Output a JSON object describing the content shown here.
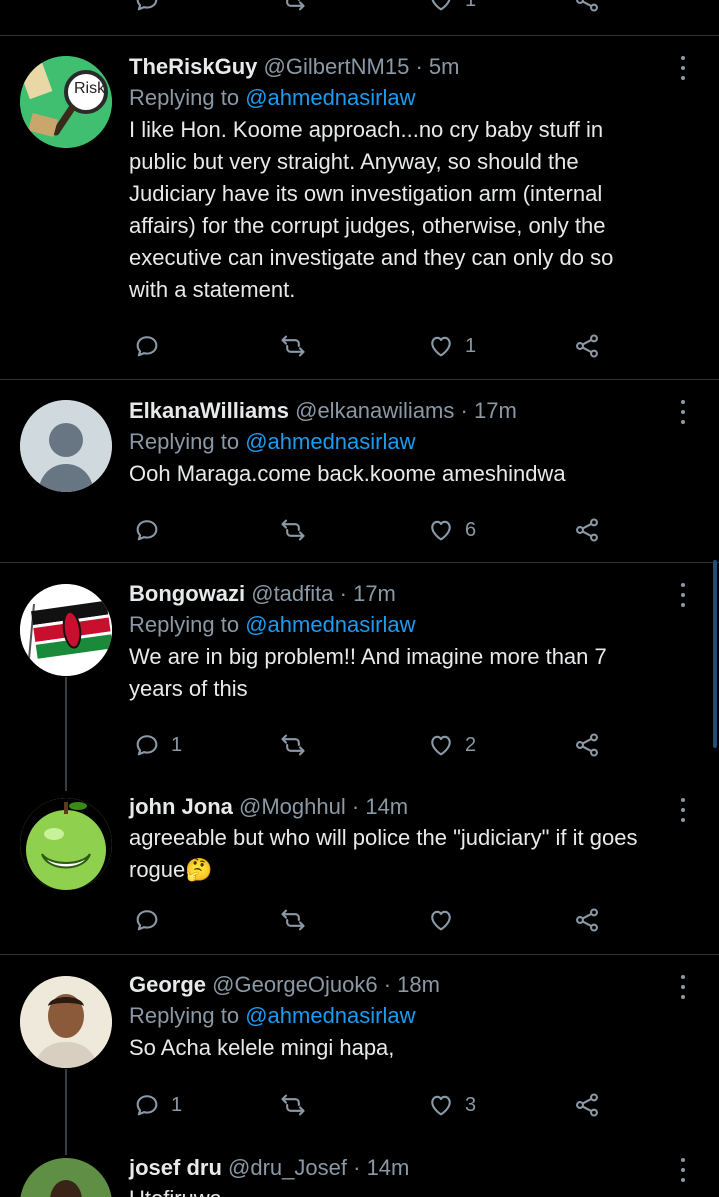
{
  "tweets": [
    {
      "name": "TheRiskGuy",
      "handle": "@GilbertNM15",
      "time": "5m",
      "replying_label": "Replying to",
      "replying_to": "@ahmednasirlaw",
      "text_lines": [
        "I like Hon. Koome approach...no cry baby stuff in",
        "public but very straight. Anyway, so should the",
        "Judiciary have its own investigation arm (internal",
        "affairs) for the corrupt judges, otherwise, only the",
        "executive can investigate and they can only do so",
        "with a statement."
      ],
      "avatar_text": "Risk",
      "replies": "",
      "likes": "1"
    },
    {
      "name": "ElkanaWilliams",
      "handle": "@elkanawiliams",
      "time": "17m",
      "replying_label": "Replying to",
      "replying_to": "@ahmednasirlaw",
      "text_lines": [
        "Ooh Maraga.come back.koome ameshindwa"
      ],
      "replies": "",
      "likes": "6"
    },
    {
      "name": "Bongowazi",
      "handle": "@tadfita",
      "time": "17m",
      "replying_label": "Replying to",
      "replying_to": "@ahmednasirlaw",
      "text_lines": [
        "We are in big problem!! And imagine more than 7",
        "years of this"
      ],
      "replies": "1",
      "likes": "2"
    },
    {
      "name": "john Jona",
      "handle": "@Moghhul",
      "time": "14m",
      "text_lines": [
        "agreeable but who will police the \"judiciary\" if it goes",
        "rogue🤔"
      ],
      "replies": "",
      "likes": ""
    },
    {
      "name": "George",
      "handle": "@GeorgeOjuok6",
      "time": "18m",
      "replying_label": "Replying to",
      "replying_to": "@ahmednasirlaw",
      "text_lines": [
        "So Acha kelele mingi hapa,"
      ],
      "replies": "1",
      "likes": "3"
    },
    {
      "name": "josef dru",
      "handle": "@dru_Josef",
      "time": "14m",
      "text_lines": [
        "Utofiruwa"
      ]
    }
  ],
  "top_partial": {
    "likes": "1"
  },
  "icons": {
    "reply": "reply-icon",
    "retweet": "retweet-icon",
    "like": "heart-icon",
    "share": "share-icon",
    "more": "more-vertical-icon"
  },
  "colors": {
    "background": "#000000",
    "accent": "#1d9bf0",
    "muted": "#8b98a5",
    "text": "#e7e9ea"
  }
}
